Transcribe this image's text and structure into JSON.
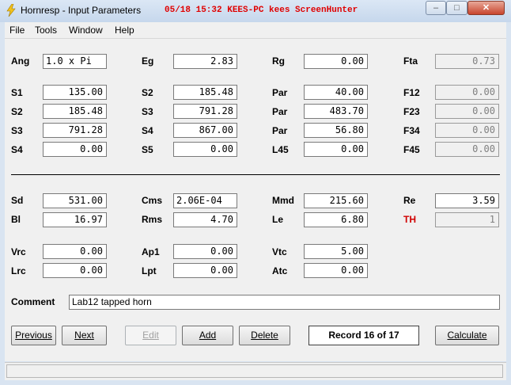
{
  "window": {
    "title": "Hornresp - Input Parameters",
    "overlay": "05/18 15:32 KEES-PC kees ScreenHunter",
    "controls": {
      "minimize": "–",
      "maximize": "□",
      "close": "✕"
    }
  },
  "menu": [
    "File",
    "Tools",
    "Window",
    "Help"
  ],
  "params": {
    "ang": {
      "label": "Ang",
      "value": "1.0 x Pi"
    },
    "eg": {
      "label": "Eg",
      "value": "2.83"
    },
    "rg": {
      "label": "Rg",
      "value": "0.00"
    },
    "fta": {
      "label": "Fta",
      "value": "0.73"
    },
    "s1": {
      "label": "S1",
      "value": "135.00"
    },
    "s2a": {
      "label": "S2",
      "value": "185.48"
    },
    "par1": {
      "label": "Par",
      "value": "40.00"
    },
    "f12": {
      "label": "F12",
      "value": "0.00"
    },
    "s2b": {
      "label": "S2",
      "value": "185.48"
    },
    "s3a": {
      "label": "S3",
      "value": "791.28"
    },
    "par2": {
      "label": "Par",
      "value": "483.70"
    },
    "f23": {
      "label": "F23",
      "value": "0.00"
    },
    "s3b": {
      "label": "S3",
      "value": "791.28"
    },
    "s4a": {
      "label": "S4",
      "value": "867.00"
    },
    "par3": {
      "label": "Par",
      "value": "56.80"
    },
    "f34": {
      "label": "F34",
      "value": "0.00"
    },
    "s4b": {
      "label": "S4",
      "value": "0.00"
    },
    "s5": {
      "label": "S5",
      "value": "0.00"
    },
    "l45": {
      "label": "L45",
      "value": "0.00"
    },
    "f45": {
      "label": "F45",
      "value": "0.00"
    },
    "sd": {
      "label": "Sd",
      "value": "531.00"
    },
    "cms": {
      "label": "Cms",
      "value": "2.06E-04"
    },
    "mmd": {
      "label": "Mmd",
      "value": "215.60"
    },
    "re": {
      "label": "Re",
      "value": "3.59"
    },
    "bl": {
      "label": "Bl",
      "value": "16.97"
    },
    "rms": {
      "label": "Rms",
      "value": "4.70"
    },
    "le": {
      "label": "Le",
      "value": "6.80"
    },
    "th": {
      "label": "TH",
      "value": "1"
    },
    "vrc": {
      "label": "Vrc",
      "value": "0.00"
    },
    "ap1": {
      "label": "Ap1",
      "value": "0.00"
    },
    "vtc": {
      "label": "Vtc",
      "value": "5.00"
    },
    "lrc": {
      "label": "Lrc",
      "value": "0.00"
    },
    "lpt": {
      "label": "Lpt",
      "value": "0.00"
    },
    "atc": {
      "label": "Atc",
      "value": "0.00"
    }
  },
  "comment": {
    "label": "Comment",
    "value": "Lab12 tapped horn"
  },
  "buttons": {
    "previous": "Previous",
    "next": "Next",
    "edit": "Edit",
    "add": "Add",
    "delete": "Delete",
    "record": "Record 16 of 17",
    "calculate": "Calculate"
  },
  "colors": {
    "title_overlay": "#e00000",
    "th_label": "#d00000"
  }
}
